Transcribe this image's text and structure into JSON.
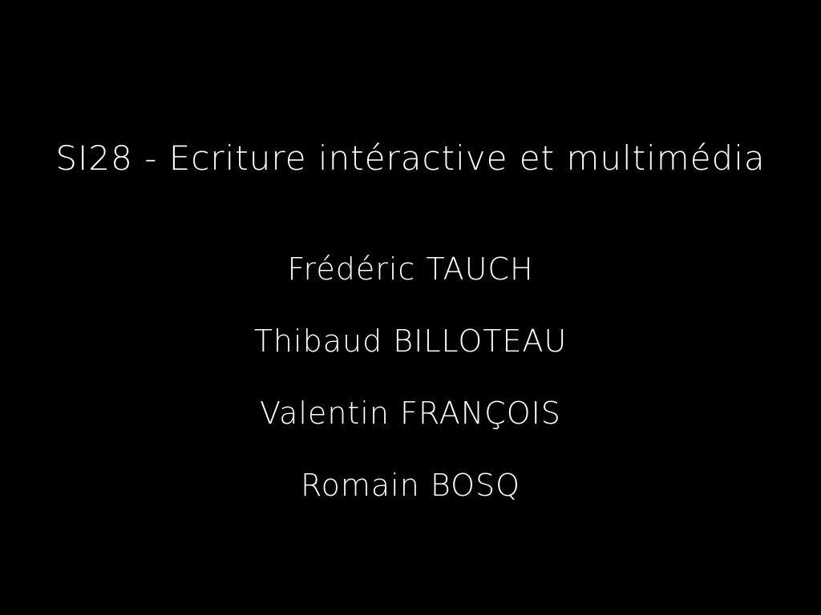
{
  "slide": {
    "title": "SI28 - Ecriture intéractive et multimédia",
    "authors": [
      "Frédéric TAUCH",
      "Thibaud BILLOTEAU",
      "Valentin FRANÇOIS",
      "Romain BOSQ"
    ]
  },
  "colors": {
    "background": "#000000",
    "text": "#ffffff"
  }
}
